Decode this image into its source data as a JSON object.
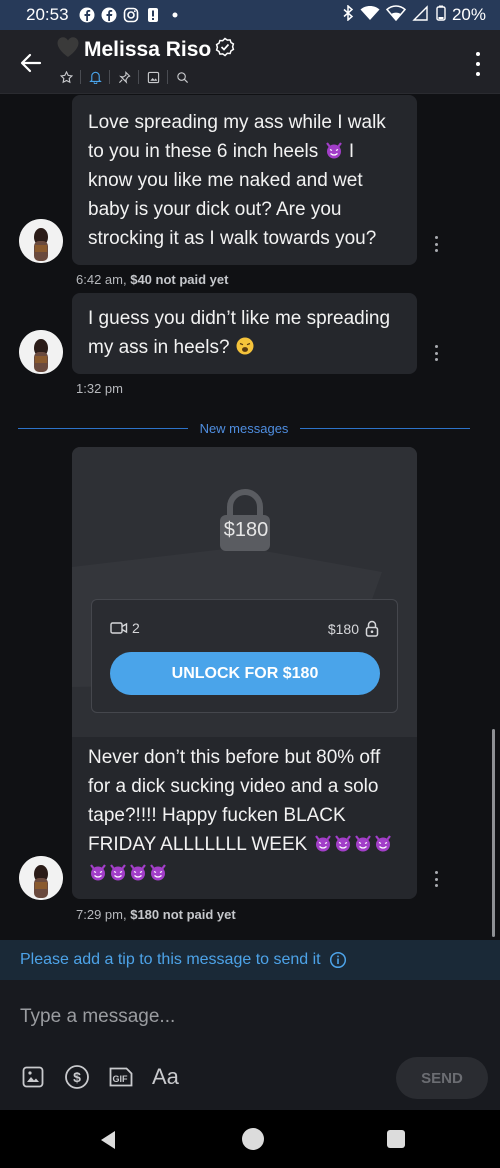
{
  "status_bar": {
    "time": "20:53",
    "battery": "20%",
    "notification_icons": [
      "facebook-icon",
      "facebook-icon",
      "instagram-icon",
      "alert-icon",
      "dot-icon"
    ]
  },
  "header": {
    "title": "Melissa Riso",
    "title_prefix_icon": "black-heart-icon",
    "verified_icon": "verified-badge-icon",
    "toolbar_icons": [
      "star-icon",
      "bell-icon",
      "pin-icon",
      "image-icon",
      "search-icon"
    ]
  },
  "messages": [
    {
      "text": "Love spreading my ass while I walk to you in these 6 inch heels 😈 I know you like me naked and wet baby is your dick out? Are you strocking it as I walk towards you?",
      "lines": [
        "Love spreading my ass while I walk",
        "to you in these 6 inch heels",
        "I",
        "know you like me naked and wet",
        "baby is your dick out? Are you",
        "strocking it as I walk towards you?"
      ],
      "time": "6:42 am,",
      "price_note": "$40 not paid yet"
    },
    {
      "lines": [
        "I guess you didn’t like me spreading",
        "my ass in heels?"
      ],
      "time": "1:32 pm",
      "price_note": ""
    },
    {
      "lines": [
        "Never don’t this before but 80% off",
        "for a dick sucking video and a solo",
        "tape?!!!! Happy fucken BLACK",
        "FRIDAY ALLLLLLL WEEK"
      ],
      "time": "7:29 pm,",
      "price_note": "$180 not paid yet",
      "locked": {
        "price_badge": "$180",
        "media_count": "2",
        "price": "$180",
        "unlock_label": "UNLOCK FOR $180"
      }
    }
  ],
  "divider_label": "New messages",
  "tip_banner": "Please add a tip to this message to send it",
  "composer": {
    "placeholder": "Type a message...",
    "send_label": "SEND",
    "font_label": "Aa"
  },
  "colors": {
    "accent": "#4aa4ea",
    "status_bar": "#273a59",
    "bubble": "#25272c",
    "devil_emoji": "#a23ec8"
  }
}
